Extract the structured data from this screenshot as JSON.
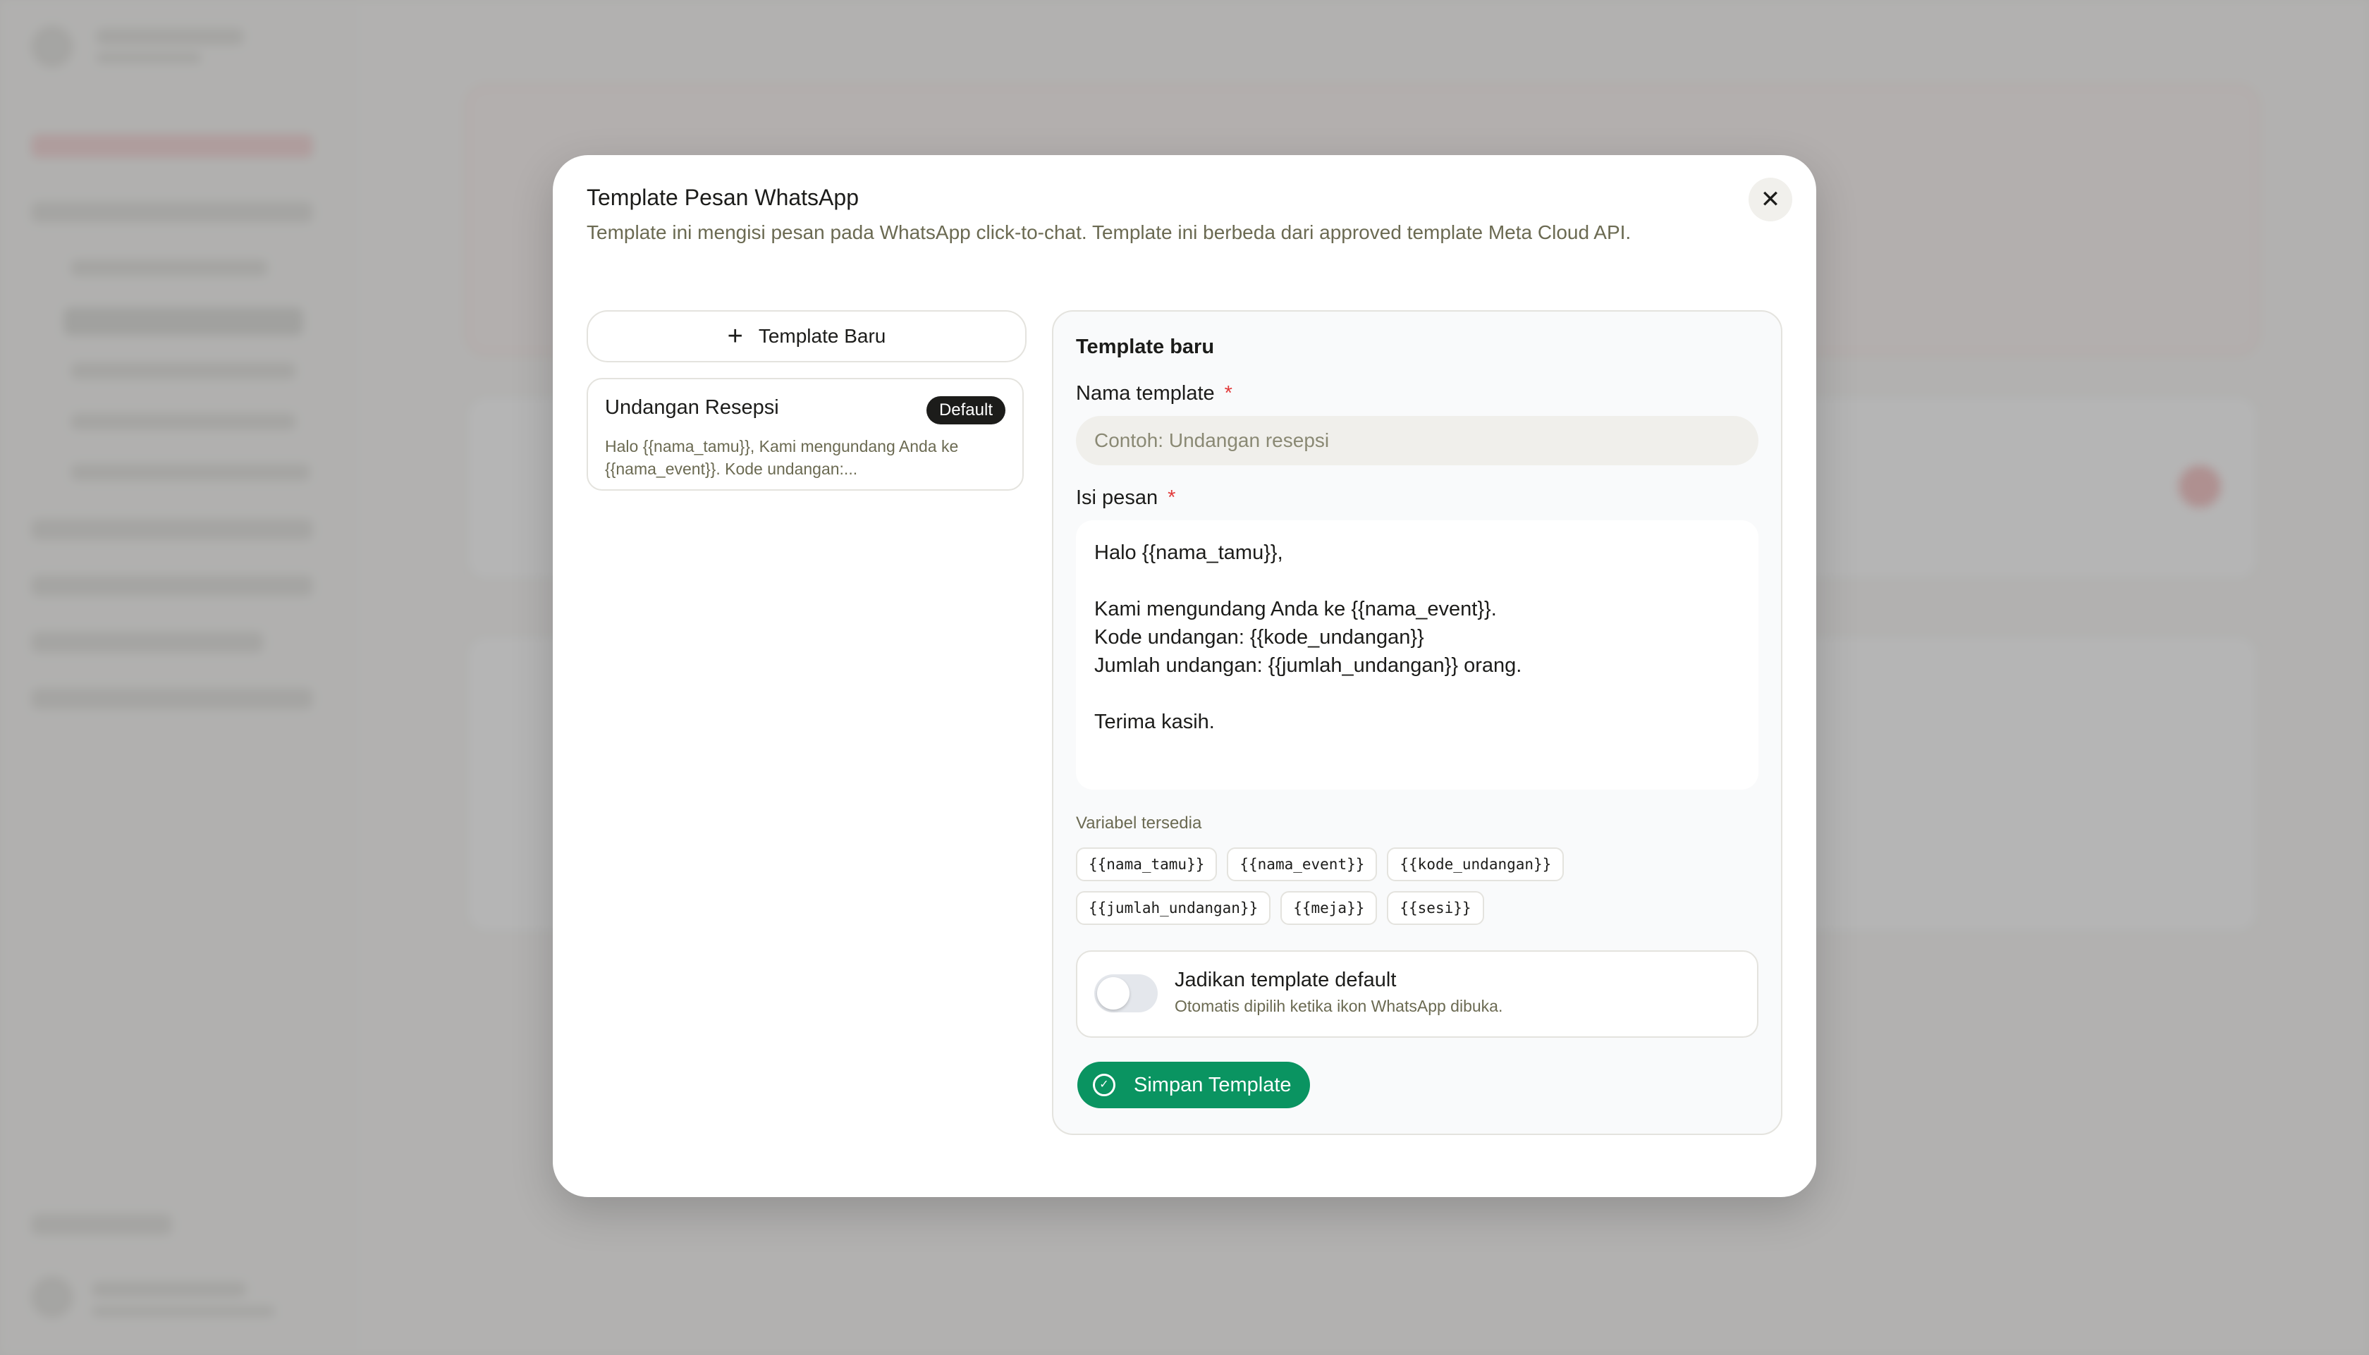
{
  "modal": {
    "title": "Template Pesan WhatsApp",
    "description": "Template ini mengisi pesan pada WhatsApp click-to-chat. Template ini berbeda dari approved template Meta Cloud API.",
    "close_icon": "close-icon"
  },
  "template_list": {
    "new_button_label": "Template Baru",
    "items": [
      {
        "name": "Undangan Resepsi",
        "badge": "Default",
        "preview_line1": "Halo {{nama_tamu}}, Kami mengundang Anda ke",
        "preview_line2": "{{nama_event}}. Kode undangan:..."
      }
    ]
  },
  "form": {
    "heading": "Template baru",
    "name_label": "Nama template",
    "name_placeholder": "Contoh: Undangan resepsi",
    "name_value": "",
    "message_label": "Isi pesan",
    "required_mark": "*",
    "message_lines": [
      "Halo {{nama_tamu}},",
      "",
      "Kami mengundang Anda ke {{nama_event}}.",
      "Kode undangan: {{kode_undangan}}",
      "Jumlah undangan: {{jumlah_undangan}} orang.",
      "",
      "Terima kasih."
    ],
    "variables_label": "Variabel tersedia",
    "variables": [
      "{{nama_tamu}}",
      "{{nama_event}}",
      "{{kode_undangan}}",
      "{{jumlah_undangan}}",
      "{{meja}}",
      "{{sesi}}"
    ],
    "default_toggle": {
      "title": "Jadikan template default",
      "subtitle": "Otomatis dipilih ketika ikon WhatsApp dibuka.",
      "enabled": false
    },
    "save_button_label": "Simpan Template"
  },
  "colors": {
    "primary_green": "#0a9461",
    "required_red": "#e23b3b",
    "muted_olive": "#6b6a52",
    "badge_dark": "#1c1c1a"
  }
}
